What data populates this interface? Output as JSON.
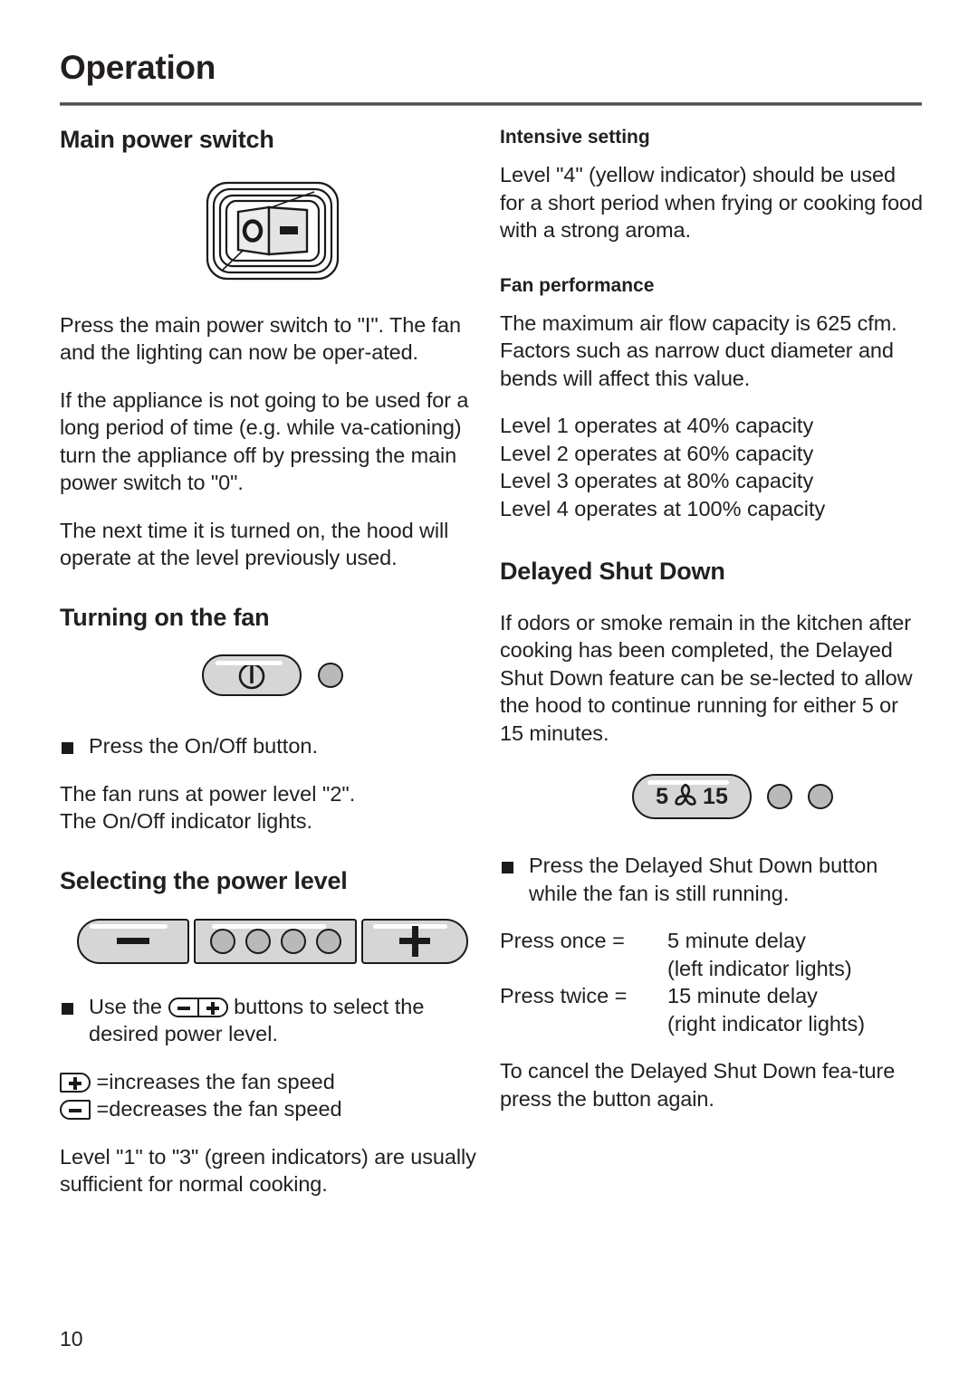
{
  "page": {
    "title": "Operation",
    "number": "10"
  },
  "left_column": {
    "main_power": {
      "heading": "Main power switch",
      "figure": {
        "name": "rocker-switch",
        "off_symbol": "O",
        "on_symbol": "I"
      },
      "paragraphs": [
        "Press the main power switch to \"I\". The fan and the lighting can now be oper-ated.",
        "If the appliance is not going to be used for a long period of time (e.g. while va-cationing) turn the appliance off by pressing the main power switch to \"0\".",
        "The next time it is turned on, the hood will operate at the level previously used."
      ]
    },
    "turning_on_fan": {
      "heading": "Turning on the fan",
      "figure": {
        "button": "on-off-button",
        "indicator": "on-off-indicator"
      },
      "bullet": "Press the On/Off button.",
      "result_lines": [
        "The fan runs at power level \"2\".",
        "The On/Off indicator lights."
      ]
    },
    "selecting_power": {
      "heading": "Selecting the power level",
      "figure": {
        "minus_label": "minus-button",
        "plus_label": "plus-button",
        "indicator_count": 4
      },
      "bullet_prefix": "Use the",
      "bullet_suffix": "buttons to select the",
      "bullet_line2": "desired power level.",
      "legend": [
        {
          "icon": "plus",
          "text": "=increases the fan speed"
        },
        {
          "icon": "minus",
          "text": "=decreases the fan speed"
        }
      ],
      "note": "Level \"1\" to \"3\" (green indicators) are usually sufficient for normal cooking."
    }
  },
  "right_column": {
    "intensive": {
      "heading": "Intensive setting",
      "body": "Level \"4\" (yellow indicator) should be used for a short period when frying or cooking food with a strong aroma."
    },
    "fan_performance": {
      "heading": "Fan performance",
      "body": "The maximum air flow capacity is 625 cfm. Factors such as narrow duct diameter and bends will affect this value.",
      "levels": [
        "Level 1 operates at 40% capacity",
        "Level 2 operates at 60% capacity",
        "Level 3 operates at 80% capacity",
        "Level 4 operates at 100% capacity"
      ]
    },
    "delayed_shutdown": {
      "heading": "Delayed Shut Down",
      "body": "If odors or smoke remain in the kitchen after cooking has been completed, the Delayed Shut Down feature can be se-lected to allow the hood to continue running for either 5 or 15 minutes.",
      "figure": {
        "left_number": "5",
        "fan_icon": "fan-blade-icon",
        "right_number": "15",
        "indicator_left": "left-indicator",
        "indicator_right": "right-indicator"
      },
      "bullet_line1": "Press the Delayed Shut Down button",
      "bullet_line2": "while the fan is still running.",
      "press_rows": [
        {
          "label": "Press once =",
          "value": "5 minute delay",
          "sub": "(left indicator lights)"
        },
        {
          "label": "Press twice =",
          "value": "15 minute delay",
          "sub": "(right indicator lights)"
        }
      ],
      "cancel_note": "To cancel the Delayed Shut Down fea-ture press the button again."
    }
  },
  "colors": {
    "text": "#231f20",
    "rule": "#4c4c4c",
    "button_face": "#d6d6d6",
    "indicator": "#b9b9b9",
    "outline": "#1a1a1a"
  }
}
